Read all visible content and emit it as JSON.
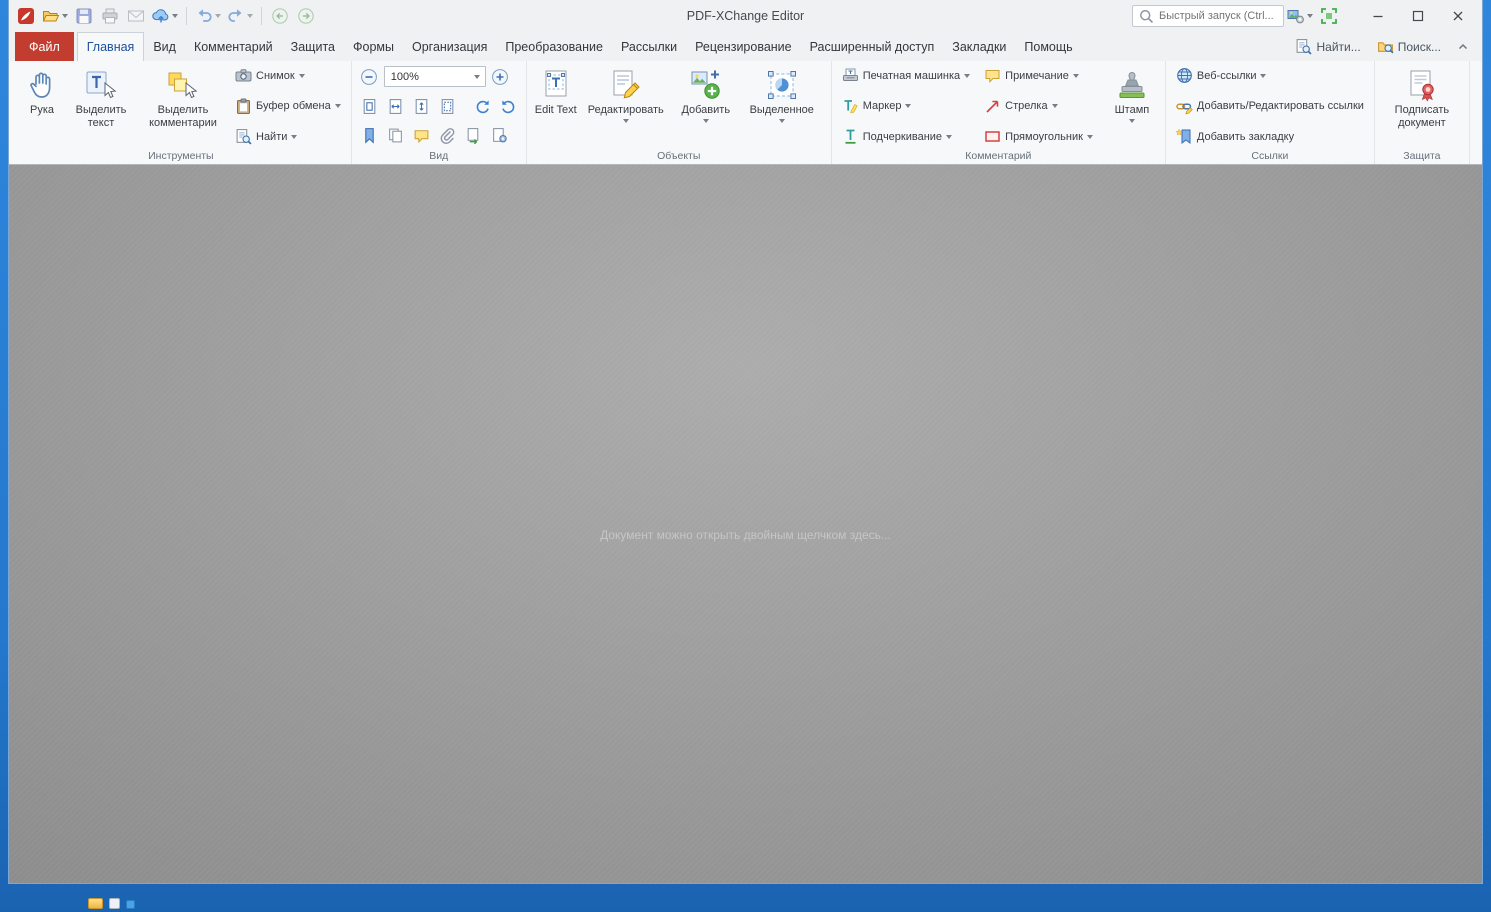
{
  "window": {
    "title": "PDF-XChange Editor",
    "quick_search_placeholder": "Быстрый запуск (Ctrl...",
    "document_hint": "Документ можно открыть двойным щелчком здесь..."
  },
  "colors": {
    "file_tab_red": "#c23d30",
    "window_frame_blue": "#2478cd",
    "active_tab_text": "#1d4f9c"
  },
  "tabs": {
    "file": "Файл",
    "active": "Главная",
    "items": [
      "Главная",
      "Вид",
      "Комментарий",
      "Защита",
      "Формы",
      "Организация",
      "Преобразование",
      "Рассылки",
      "Рецензирование",
      "Расширенный доступ",
      "Закладки",
      "Помощь"
    ],
    "find": "Найти...",
    "search": "Поиск..."
  },
  "ribbon": {
    "tools": {
      "label": "Инструменты",
      "hand": "Рука",
      "select_text": "Выделить текст",
      "select_comments": "Выделить комментарии",
      "snapshot": "Снимок",
      "clipboard": "Буфер обмена",
      "find": "Найти"
    },
    "view": {
      "label": "Вид",
      "zoom": "100%"
    },
    "objects": {
      "label": "Объекты",
      "edit_text": "Edit Text",
      "edit": "Редактировать",
      "add": "Добавить",
      "selected": "Выделенное"
    },
    "comment": {
      "label": "Комментарий",
      "typewriter": "Печатная машинка",
      "highlighter": "Маркер",
      "underline": "Подчеркивание",
      "note": "Примечание",
      "arrow": "Стрелка",
      "rectangle": "Прямоугольник",
      "stamp": "Штамп"
    },
    "links": {
      "label": "Ссылки",
      "web_links": "Веб-ссылки",
      "add_edit_links": "Добавить/Редактировать ссылки",
      "add_bookmark": "Добавить закладку"
    },
    "protection": {
      "label": "Защита",
      "sign": "Подписать документ"
    }
  }
}
